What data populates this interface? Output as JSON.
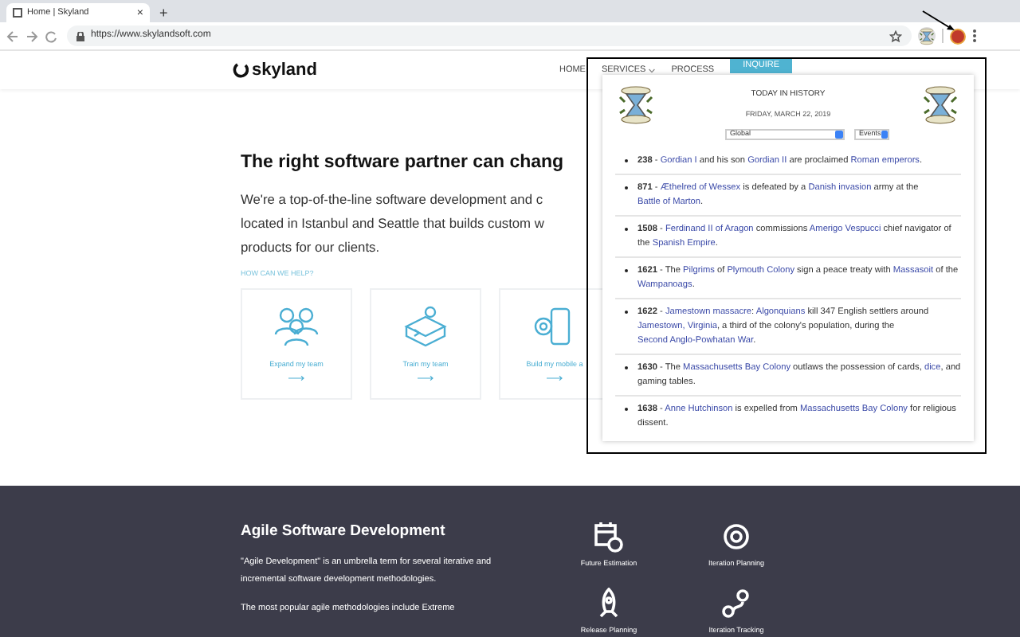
{
  "browser": {
    "tab_title": "Home | Skyland",
    "tab_close": "×",
    "new_tab": "+",
    "url": "https://www.skylandsoft.com"
  },
  "site": {
    "logo": "skyland",
    "nav": [
      {
        "label": "HOME",
        "kind": "link"
      },
      {
        "label": "SERVICES",
        "kind": "dropdown"
      },
      {
        "label": "PROCESS",
        "kind": "link"
      },
      {
        "label": "INQUIRE",
        "kind": "button"
      }
    ],
    "heading": "The right software partner can chang",
    "intro_lines": [
      "We're a top-of-the-line software development and c",
      "located in Istanbul and Seattle that builds custom w",
      "products for our clients."
    ],
    "help_label": "HOW CAN WE HELP?",
    "cards": [
      {
        "label": "Expand my team",
        "kind": "team"
      },
      {
        "label": "Train my team",
        "kind": "train"
      },
      {
        "label": "Build my mobile a",
        "kind": "mobile"
      }
    ],
    "agile": {
      "title": "Agile Software Development",
      "paragraphs": [
        "\"Agile Development\" is an umbrella term for several iterative and incremental software development methodologies.",
        "The most popular agile methodologies include Extreme"
      ],
      "features": [
        {
          "label": "Future Estimation",
          "kind": "calendar"
        },
        {
          "label": "Iteration Planning",
          "kind": "cycle"
        },
        {
          "label": "Release Planning",
          "kind": "rocket"
        },
        {
          "label": "Iteration Tracking",
          "kind": "route"
        }
      ]
    }
  },
  "popup": {
    "title": "TODAY IN HISTORY",
    "date": "FRIDAY, MARCH 22, 2019",
    "region_select": "Global",
    "type_select": "Events",
    "separator": " - ",
    "events": [
      {
        "year": "238",
        "parts": [
          {
            "text": "Gordian I",
            "link": true
          },
          {
            "text": " and his son ",
            "link": false
          },
          {
            "text": "Gordian II",
            "link": true
          },
          {
            "text": " are proclaimed ",
            "link": false
          },
          {
            "text": "Roman emperors",
            "link": true
          },
          {
            "text": ".",
            "link": false
          }
        ]
      },
      {
        "year": "871",
        "parts": [
          {
            "text": "Æthelred of Wessex",
            "link": true
          },
          {
            "text": " is defeated by a ",
            "link": false
          },
          {
            "text": "Danish invasion",
            "link": true
          },
          {
            "text": " army at the ",
            "link": false
          },
          {
            "text": "Battle of Marton",
            "link": true
          },
          {
            "text": ".",
            "link": false
          }
        ]
      },
      {
        "year": "1508",
        "parts": [
          {
            "text": "Ferdinand II of Aragon",
            "link": true
          },
          {
            "text": " commissions ",
            "link": false
          },
          {
            "text": "Amerigo Vespucci",
            "link": true
          },
          {
            "text": " chief navigator of the ",
            "link": false
          },
          {
            "text": "Spanish Empire",
            "link": true
          },
          {
            "text": ".",
            "link": false
          }
        ]
      },
      {
        "year": "1621",
        "parts": [
          {
            "text": "The ",
            "link": false
          },
          {
            "text": "Pilgrims",
            "link": true
          },
          {
            "text": " of ",
            "link": false
          },
          {
            "text": "Plymouth Colony",
            "link": true
          },
          {
            "text": " sign a peace treaty with ",
            "link": false
          },
          {
            "text": "Massasoit",
            "link": true
          },
          {
            "text": " of the ",
            "link": false
          },
          {
            "text": "Wampanoags",
            "link": true
          },
          {
            "text": ".",
            "link": false
          }
        ]
      },
      {
        "year": "1622",
        "parts": [
          {
            "text": "Jamestown massacre",
            "link": true
          },
          {
            "text": ": ",
            "link": false
          },
          {
            "text": "Algonquians",
            "link": true
          },
          {
            "text": " kill 347 English settlers around ",
            "link": false
          },
          {
            "text": "Jamestown, Virginia",
            "link": true
          },
          {
            "text": ", a third of the colony's population, during the ",
            "link": false
          },
          {
            "text": "Second Anglo-Powhatan War",
            "link": true
          },
          {
            "text": ".",
            "link": false
          }
        ]
      },
      {
        "year": "1630",
        "parts": [
          {
            "text": "The ",
            "link": false
          },
          {
            "text": "Massachusetts Bay Colony",
            "link": true
          },
          {
            "text": " outlaws the possession of cards, ",
            "link": false
          },
          {
            "text": "dice",
            "link": true
          },
          {
            "text": ", and gaming tables.",
            "link": false
          }
        ]
      },
      {
        "year": "1638",
        "parts": [
          {
            "text": "Anne Hutchinson",
            "link": true
          },
          {
            "text": " is expelled from ",
            "link": false
          },
          {
            "text": "Massachusetts Bay Colony",
            "link": true
          },
          {
            "text": " for religious dissent.",
            "link": false
          }
        ]
      }
    ]
  }
}
